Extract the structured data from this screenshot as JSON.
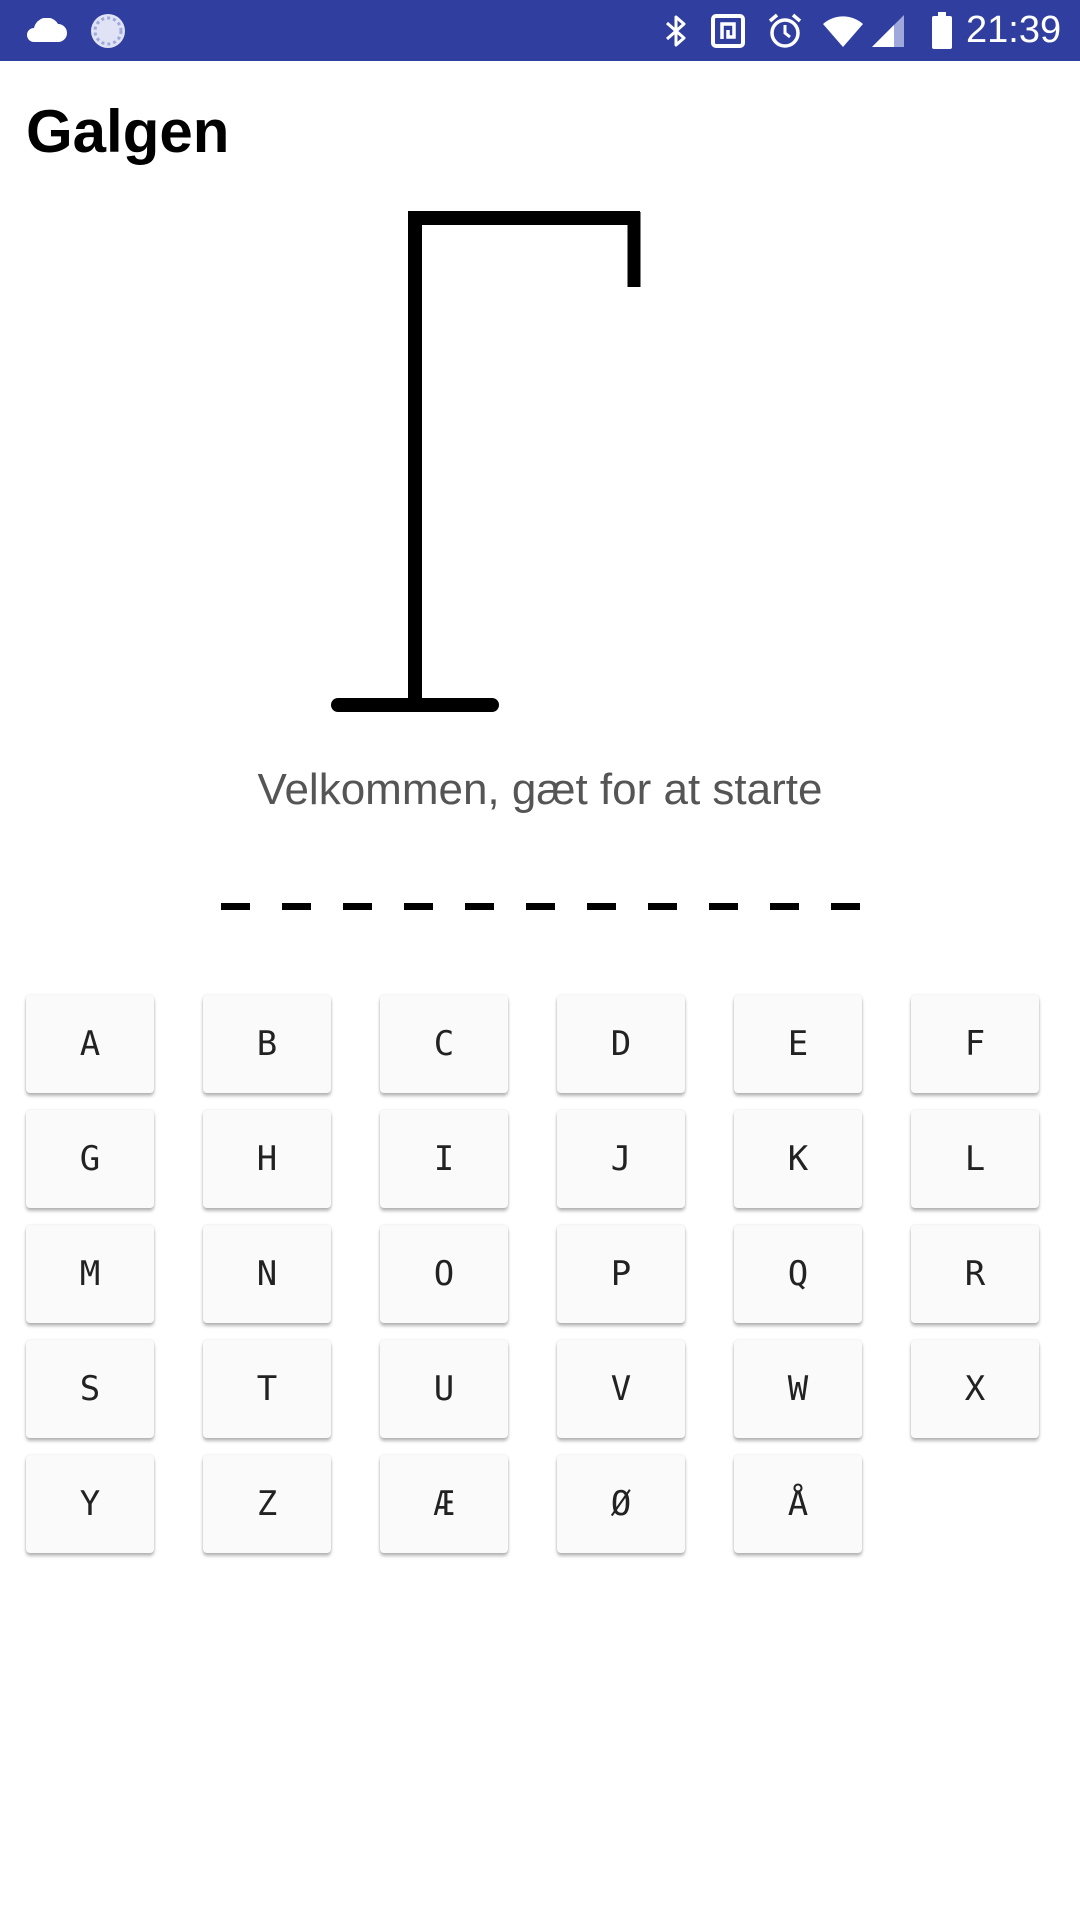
{
  "status_bar": {
    "time": "21:39",
    "icons": [
      "cloud-icon",
      "sync-icon",
      "bluetooth-icon",
      "nfc-icon",
      "alarm-icon",
      "wifi-icon",
      "cell-signal-icon",
      "battery-icon"
    ],
    "background": "#303F9F"
  },
  "app": {
    "title": "Galgen"
  },
  "game": {
    "message": "Velkommen, gæt for at starte",
    "word_slots": [
      "",
      "",
      "",
      "",
      "",
      "",
      "",
      "",
      "",
      "",
      ""
    ]
  },
  "keyboard": {
    "keys": [
      "A",
      "B",
      "C",
      "D",
      "E",
      "F",
      "G",
      "H",
      "I",
      "J",
      "K",
      "L",
      "M",
      "N",
      "O",
      "P",
      "Q",
      "R",
      "S",
      "T",
      "U",
      "V",
      "W",
      "X",
      "Y",
      "Z",
      "Æ",
      "Ø",
      "Å"
    ]
  }
}
